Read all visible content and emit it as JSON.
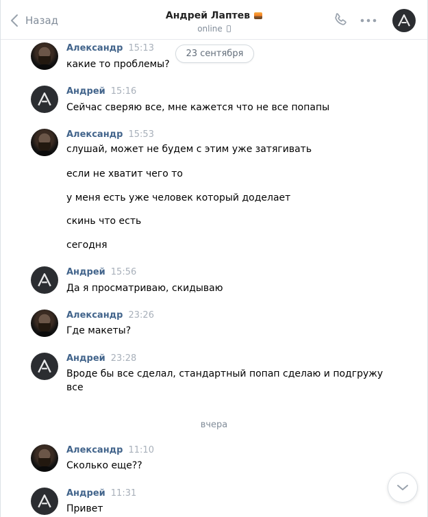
{
  "header": {
    "back_label": "Назад",
    "peer_name": "Андрей Лаптев",
    "peer_status": "online"
  },
  "date_pill": "23 сентября",
  "day_separator": "вчера",
  "messages": [
    {
      "author": "Александр",
      "time": "15:13",
      "lines": [
        "какие то проблемы?"
      ]
    },
    {
      "author": "Андрей",
      "time": "15:16",
      "lines": [
        "Сейчас сверяю все, мне кажется что не все попапы"
      ]
    },
    {
      "author": "Александр",
      "time": "15:53",
      "lines": [
        "слушай, может не будем с этим уже затягивать",
        "если не хватит чего то",
        "у меня есть уже человек который доделает",
        "скинь что есть",
        "сегодня"
      ]
    },
    {
      "author": "Андрей",
      "time": "15:56",
      "lines": [
        "Да я просматриваю, скидываю"
      ]
    },
    {
      "author": "Александр",
      "time": "23:26",
      "lines": [
        "Где макеты?"
      ]
    },
    {
      "author": "Андрей",
      "time": "23:28",
      "lines": [
        "Вроде бы все сделал, стандартный попап сделаю и подгружу",
        "все"
      ]
    },
    {
      "author": "Александр",
      "time": "11:10",
      "lines": [
        "Сколько еще??"
      ]
    },
    {
      "author": "Андрей",
      "time": "11:31",
      "lines": [
        "Привет"
      ]
    }
  ],
  "icons": {
    "back": "chevron-left-icon",
    "call": "phone-icon",
    "more": "more-horizontal-icon",
    "scroll": "chevron-down-icon"
  },
  "colors": {
    "author": "#42648b",
    "time": "#a8b0ba",
    "muted": "#818c99"
  }
}
